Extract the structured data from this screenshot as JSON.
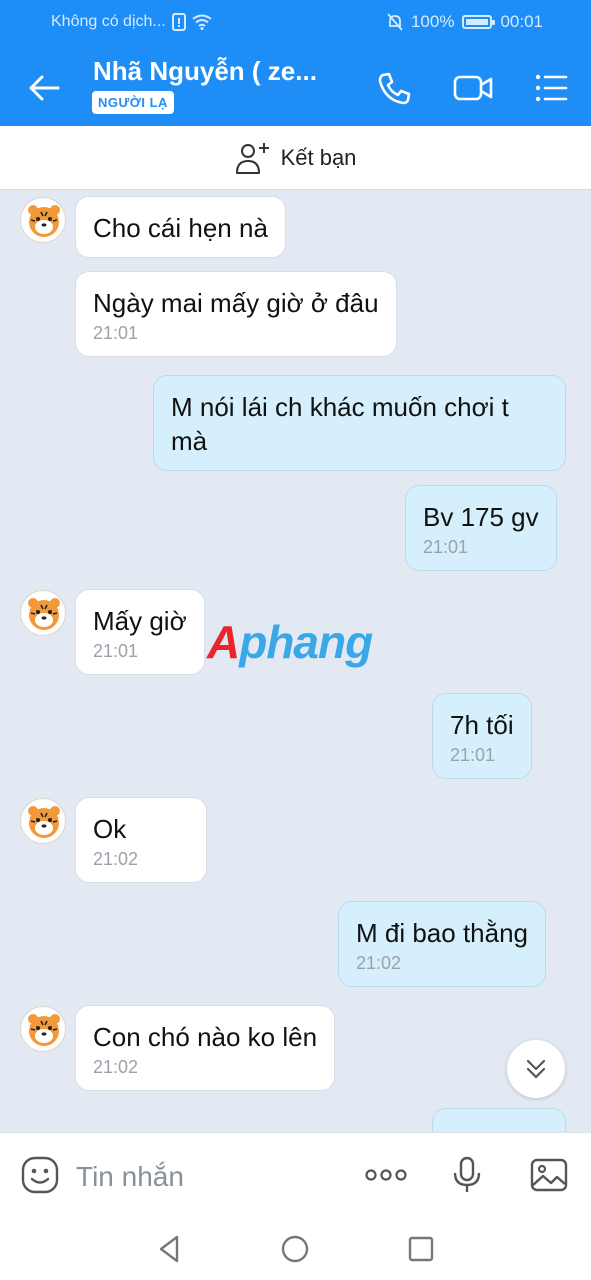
{
  "status_bar": {
    "carrier": "Không có dịch...",
    "battery": "100%",
    "time": "00:01"
  },
  "header": {
    "title": "Nhã Nguyễn ( ze...",
    "badge": "NGƯỜI LẠ"
  },
  "add_friend": {
    "label": "Kết bạn"
  },
  "watermark": {
    "part1": "A",
    "part2": "phang"
  },
  "messages": [
    {
      "side": "in",
      "text": "Cho cái hẹn nà",
      "time": ""
    },
    {
      "side": "in",
      "text": "Ngày mai mấy giờ ở đâu",
      "time": "21:01"
    },
    {
      "side": "out",
      "text": "M nói lái ch khác muốn chơi t mà",
      "time": ""
    },
    {
      "side": "out",
      "text": "Bv 175 gv",
      "time": "21:01"
    },
    {
      "side": "in",
      "text": "Mấy giờ",
      "time": "21:01"
    },
    {
      "side": "out",
      "text": "7h tối",
      "time": "21:01"
    },
    {
      "side": "in",
      "text": "Ok",
      "time": "21:02"
    },
    {
      "side": "out",
      "text": "M đi bao thằng",
      "time": "21:02"
    },
    {
      "side": "in",
      "text": "Con chó nào ko lên",
      "time": "21:02"
    }
  ],
  "composer": {
    "placeholder": "Tin nhắn"
  },
  "icons": {
    "back": "arrow-left-icon",
    "call": "phone-icon",
    "video": "video-camera-icon",
    "menu": "list-menu-icon",
    "add_friend": "person-plus-icon",
    "emoji": "smiley-icon",
    "more": "more-dots-icon",
    "mic": "microphone-icon",
    "image": "image-icon",
    "scroll_down": "double-chevron-down-icon"
  },
  "colors": {
    "header": "#1e8df5",
    "outgoing_bubble": "#d5f0fc",
    "incoming_bubble": "#ffffff",
    "chat_bg": "#e2e9f2"
  }
}
